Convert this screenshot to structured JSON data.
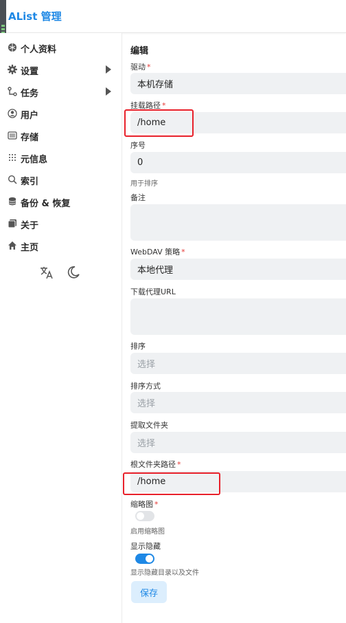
{
  "header": {
    "title": "AList 管理"
  },
  "sidebar": {
    "items": [
      {
        "label": "个人资料",
        "icon": "profile-icon"
      },
      {
        "label": "设置",
        "icon": "gear-icon",
        "has_children": true
      },
      {
        "label": "任务",
        "icon": "task-icon",
        "has_children": true
      },
      {
        "label": "用户",
        "icon": "user-icon"
      },
      {
        "label": "存储",
        "icon": "storage-icon"
      },
      {
        "label": "元信息",
        "icon": "meta-icon"
      },
      {
        "label": "索引",
        "icon": "search-icon"
      },
      {
        "label": "备份 & 恢复",
        "icon": "database-icon"
      },
      {
        "label": "关于",
        "icon": "about-icon"
      },
      {
        "label": "主页",
        "icon": "home-icon"
      }
    ],
    "tools": [
      "translate-icon",
      "moon-icon"
    ]
  },
  "form": {
    "title": "编辑",
    "driver": {
      "label": "驱动",
      "value": "本机存储"
    },
    "mount_path": {
      "label": "挂载路径",
      "value": "/home"
    },
    "order": {
      "label": "序号",
      "value": "0",
      "hint": "用于排序"
    },
    "remark": {
      "label": "备注",
      "value": ""
    },
    "webdav_policy": {
      "label": "WebDAV 策略",
      "value": "本地代理"
    },
    "download_proxy_url": {
      "label": "下载代理URL",
      "value": ""
    },
    "sort": {
      "label": "排序",
      "placeholder": "选择"
    },
    "sort_direction": {
      "label": "排序方式",
      "placeholder": "选择"
    },
    "extract_folder": {
      "label": "提取文件夹",
      "placeholder": "选择"
    },
    "root_folder_path": {
      "label": "根文件夹路径",
      "value": "/home"
    },
    "thumbnail": {
      "label": "缩略图",
      "hint": "启用缩略图",
      "enabled": false
    },
    "show_hidden": {
      "label": "显示隐藏",
      "hint": "显示隐藏目录以及文件",
      "enabled": true
    },
    "required_mark": "*",
    "save_label": "保存"
  },
  "colors": {
    "accent": "#1e88e5",
    "highlight": "#e8202a",
    "field_bg": "#eff1f3"
  }
}
